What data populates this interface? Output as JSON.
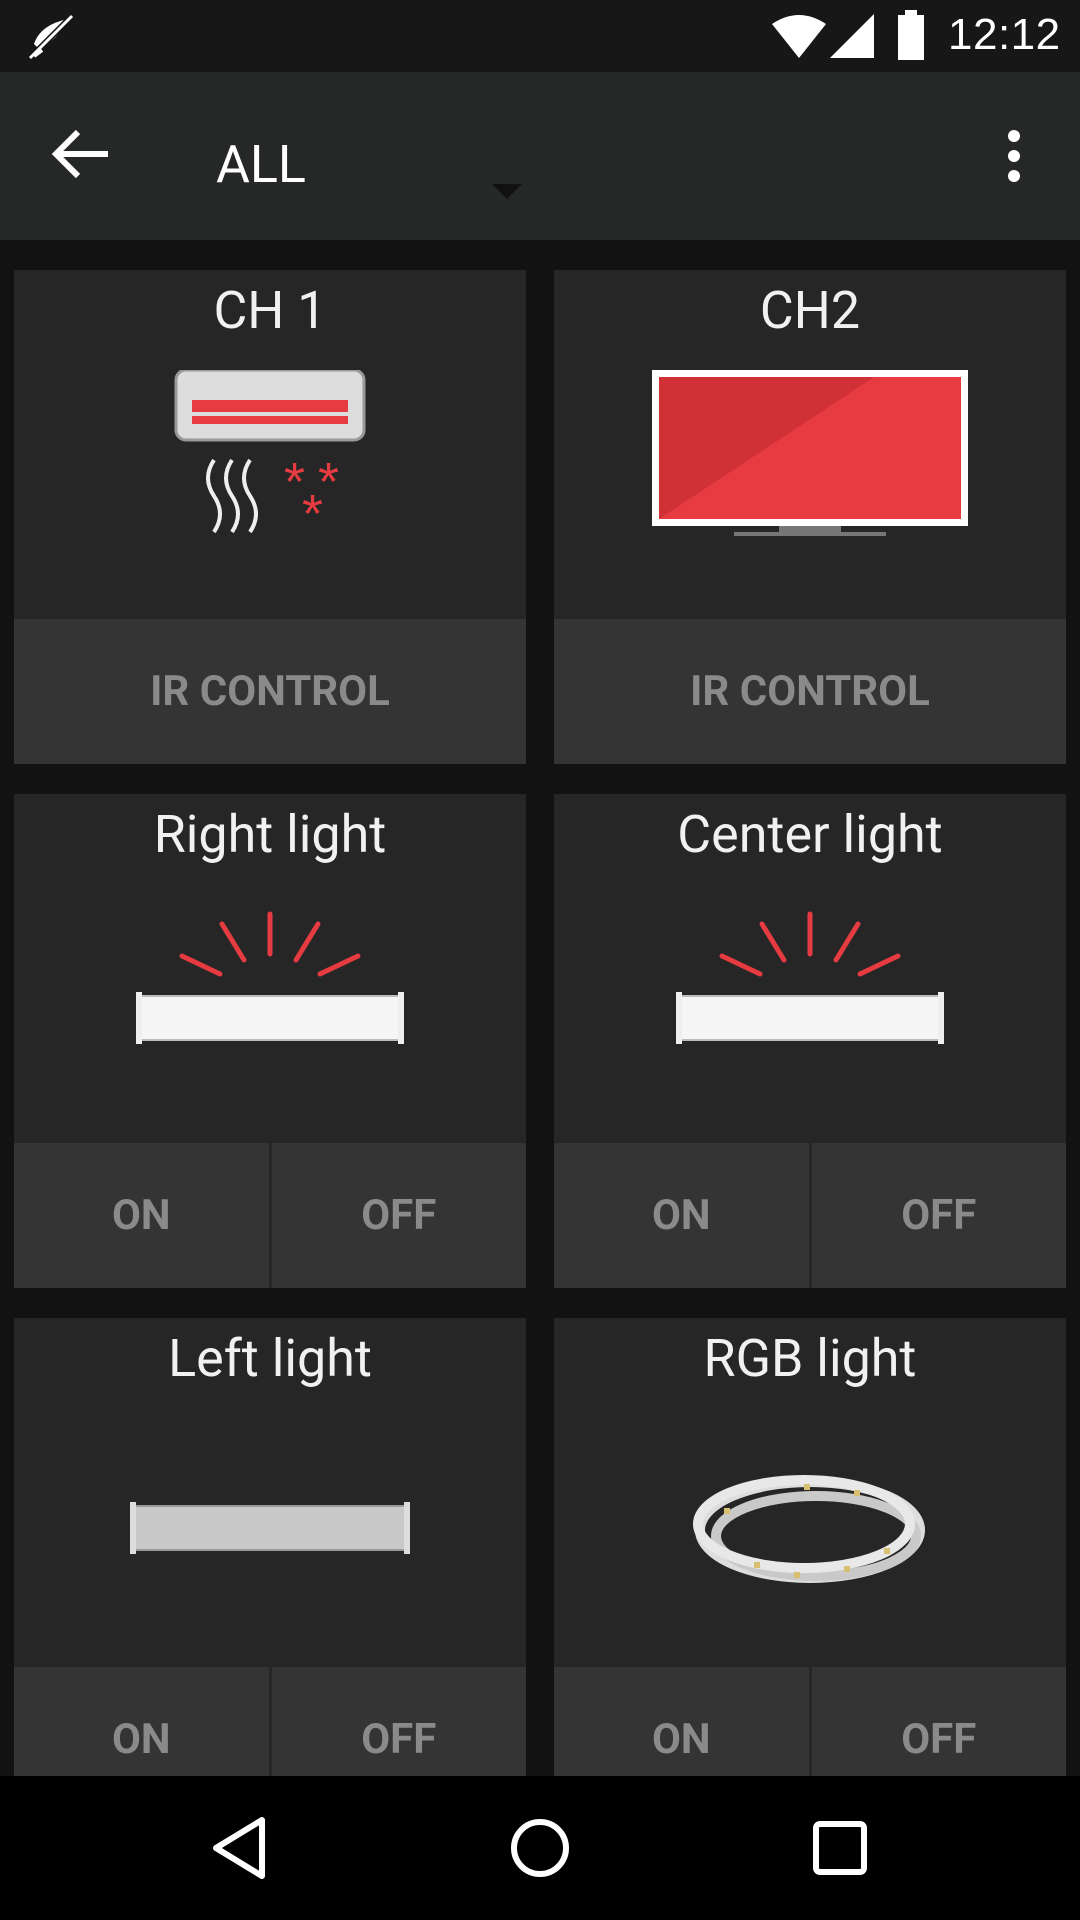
{
  "status_bar": {
    "time": "12:12",
    "icons": [
      "notifications-off-icon",
      "wifi-icon",
      "cell-signal-icon",
      "battery-icon"
    ]
  },
  "toolbar": {
    "back_icon": "arrow-back-icon",
    "filter_label": "ALL",
    "overflow_icon": "more-vert-icon"
  },
  "cards": [
    {
      "title": "CH 1",
      "icon": "air-conditioner-icon",
      "actions": [
        "IR CONTROL"
      ]
    },
    {
      "title": "CH2",
      "icon": "television-icon",
      "actions": [
        "IR CONTROL"
      ]
    },
    {
      "title": "Right light",
      "icon": "tube-light-on-icon",
      "actions": [
        "ON",
        "OFF"
      ]
    },
    {
      "title": "Center light",
      "icon": "tube-light-on-icon",
      "actions": [
        "ON",
        "OFF"
      ]
    },
    {
      "title": "Left light",
      "icon": "tube-light-off-icon",
      "actions": [
        "ON",
        "OFF"
      ]
    },
    {
      "title": "RGB light",
      "icon": "led-strip-icon",
      "actions": [
        "ON",
        "OFF"
      ]
    }
  ],
  "nav_bar": {
    "icons": [
      "nav-back-icon",
      "nav-home-icon",
      "nav-recents-icon"
    ]
  },
  "colors": {
    "accent": "#e53b41",
    "card_bg": "#252625",
    "action_bg": "#333433",
    "toolbar_bg": "#262827"
  }
}
